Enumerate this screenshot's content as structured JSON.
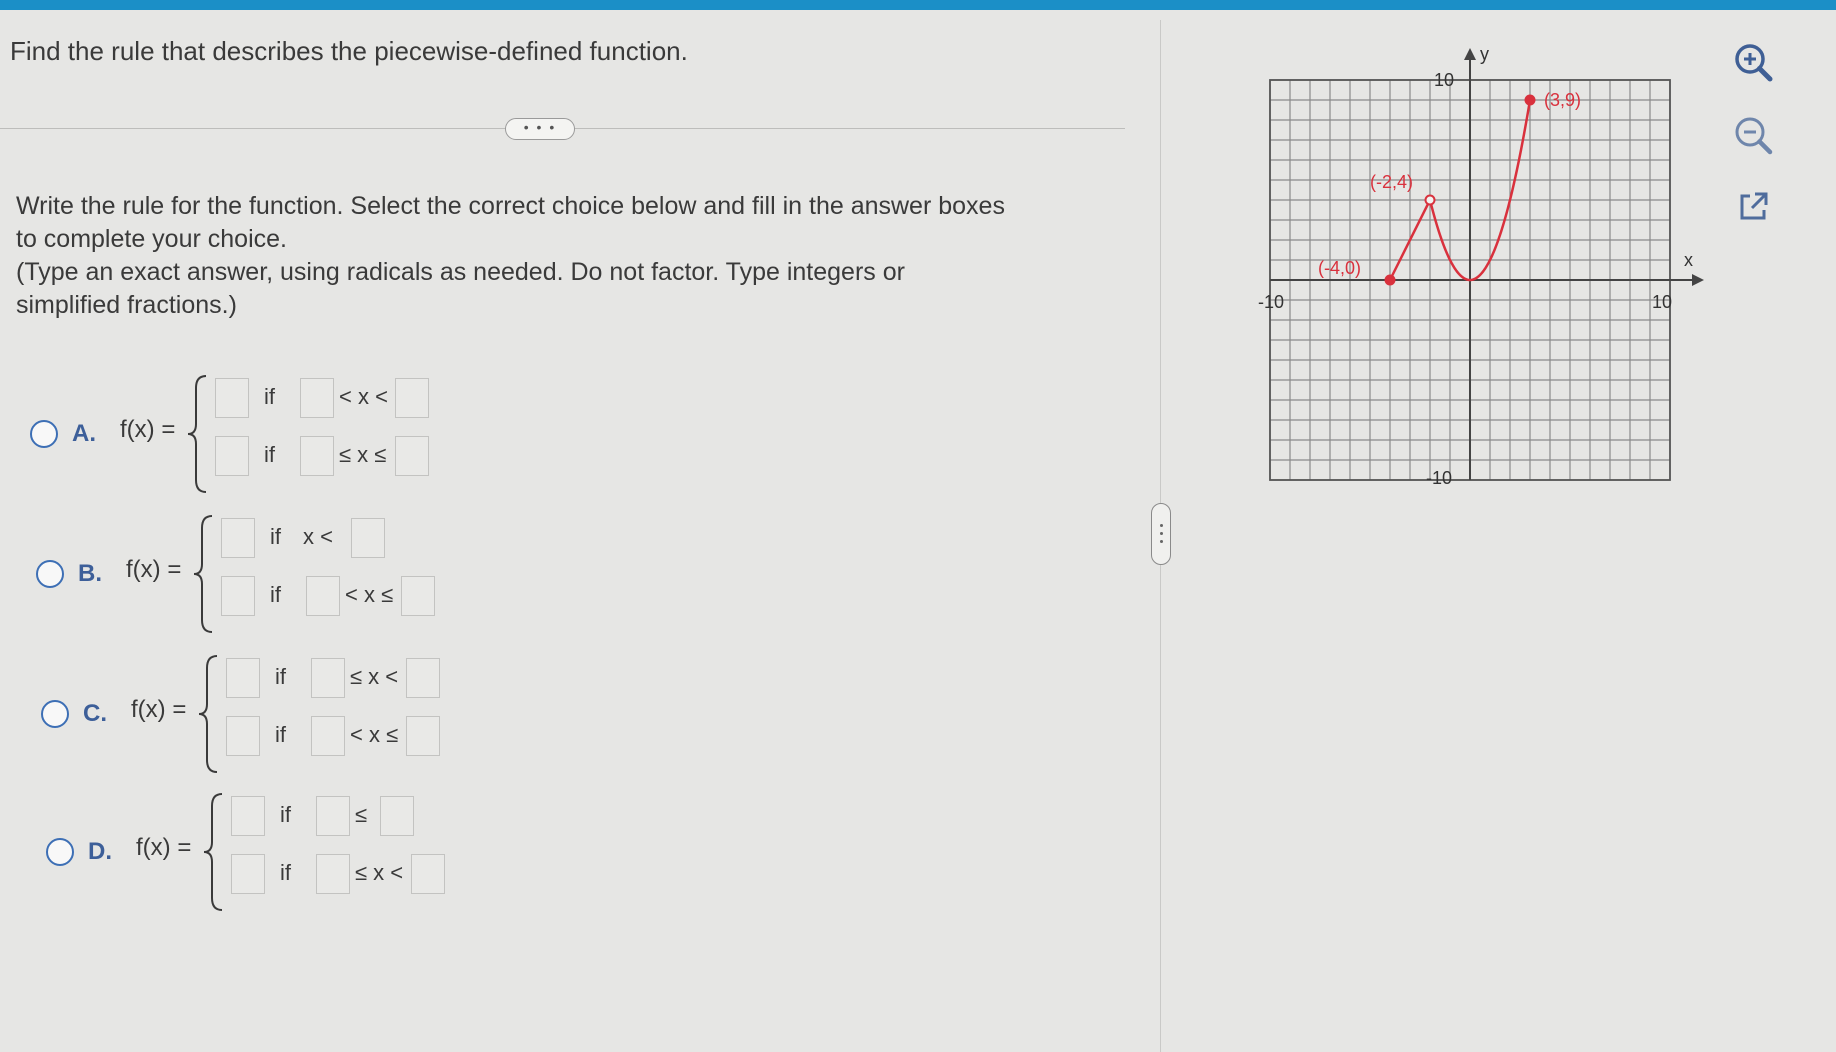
{
  "question": {
    "title": "Find the rule that describes the piecewise-defined function.",
    "expand_label": "• • •",
    "instructions": [
      "Write the rule for the function. Select the correct choice below and fill in the answer boxes",
      "to complete your choice.",
      "(Type an exact answer, using radicals as needed. Do not factor. Type integers or",
      "simplified fractions.)"
    ]
  },
  "choices": [
    {
      "letter": "A.",
      "fx": "f(x) =",
      "row1": {
        "if": "if",
        "rel": "< x <"
      },
      "row2": {
        "if": "if",
        "rel": "≤ x ≤"
      }
    },
    {
      "letter": "B.",
      "fx": "f(x) =",
      "row1": {
        "if": "if",
        "rel": "x <"
      },
      "row2": {
        "if": "if",
        "rel": "< x ≤"
      }
    },
    {
      "letter": "C.",
      "fx": "f(x) =",
      "row1": {
        "if": "if",
        "rel": "≤ x <"
      },
      "row2": {
        "if": "if",
        "rel": "< x ≤"
      }
    },
    {
      "letter": "D.",
      "fx": "f(x) =",
      "row1": {
        "if": "if",
        "rel": "≤"
      },
      "row2": {
        "if": "if",
        "rel": "≤ x <"
      }
    }
  ],
  "graph": {
    "x_axis_label": "x",
    "y_axis_label": "y",
    "tick_labels": {
      "x_min": "-10",
      "x_max": "10",
      "y_min": "-10",
      "y_max": "10"
    },
    "points": [
      {
        "label": "(-4,0)",
        "x": -4,
        "y": 0,
        "filled": true
      },
      {
        "label": "(-2,4)",
        "x": -2,
        "y": 4,
        "filled": false
      },
      {
        "label": "(3,9)",
        "x": 3,
        "y": 9,
        "filled": true
      }
    ],
    "curve_color": "#d9313d",
    "grid_color": "#8a8a8a"
  },
  "tools": {
    "zoom_in": "zoom-in-icon",
    "zoom_out": "zoom-out-icon",
    "popout": "external-link-icon"
  }
}
